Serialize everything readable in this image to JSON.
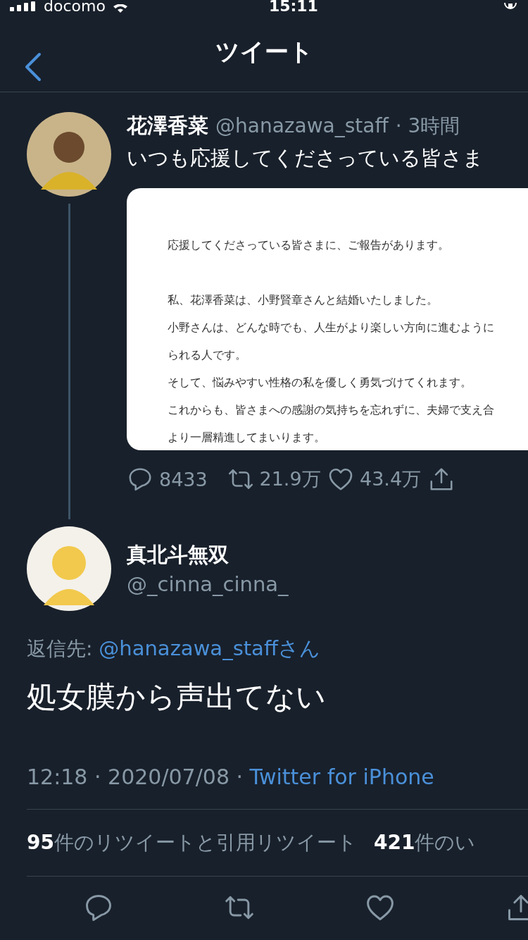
{
  "status_bar": {
    "carrier": "docomo",
    "time": "15:11"
  },
  "header": {
    "title": "ツイート"
  },
  "parent_tweet": {
    "name": "花澤香菜",
    "handle": "@hanazawa_staff",
    "time": "· 3時間",
    "text": "いつも応援してくださっている皆さま",
    "document_paragraphs": [
      [
        "応援してくださっている皆さまに、ご報告があります。"
      ],
      [
        "私、花澤香菜は、小野賢章さんと結婚いたしました。",
        "小野さんは、どんな時でも、人生がより楽しい方向に進むように",
        "られる人です。",
        "そして、悩みやすい性格の私を優しく勇気づけてくれます。",
        "これからも、皆さまへの感謝の気持ちを忘れずに、夫婦で支え合",
        "より一層精進してまいります。"
      ]
    ],
    "actions": [
      {
        "kind": "reply",
        "count": "8433"
      },
      {
        "kind": "retweet",
        "count": "21.9万"
      },
      {
        "kind": "like",
        "count": "43.4万"
      },
      {
        "kind": "share"
      }
    ]
  },
  "reply_tweet": {
    "name": "真北斗無双",
    "handle": "@_cinna_cinna_",
    "reply_to_label": "返信先: ",
    "reply_to": "@hanazawa_staffさん",
    "text": "処女膜から声出てない",
    "timestamp": "12:18 · 2020/07/08 · ",
    "source": "Twitter for iPhone"
  },
  "stats": [
    {
      "count": "95",
      "label": "件のリツイートと引用リツイート"
    },
    {
      "count": "421",
      "label": "件のい"
    }
  ],
  "action_bar": [
    {
      "kind": "reply"
    },
    {
      "kind": "retweet"
    },
    {
      "kind": "like"
    },
    {
      "kind": "share"
    }
  ]
}
